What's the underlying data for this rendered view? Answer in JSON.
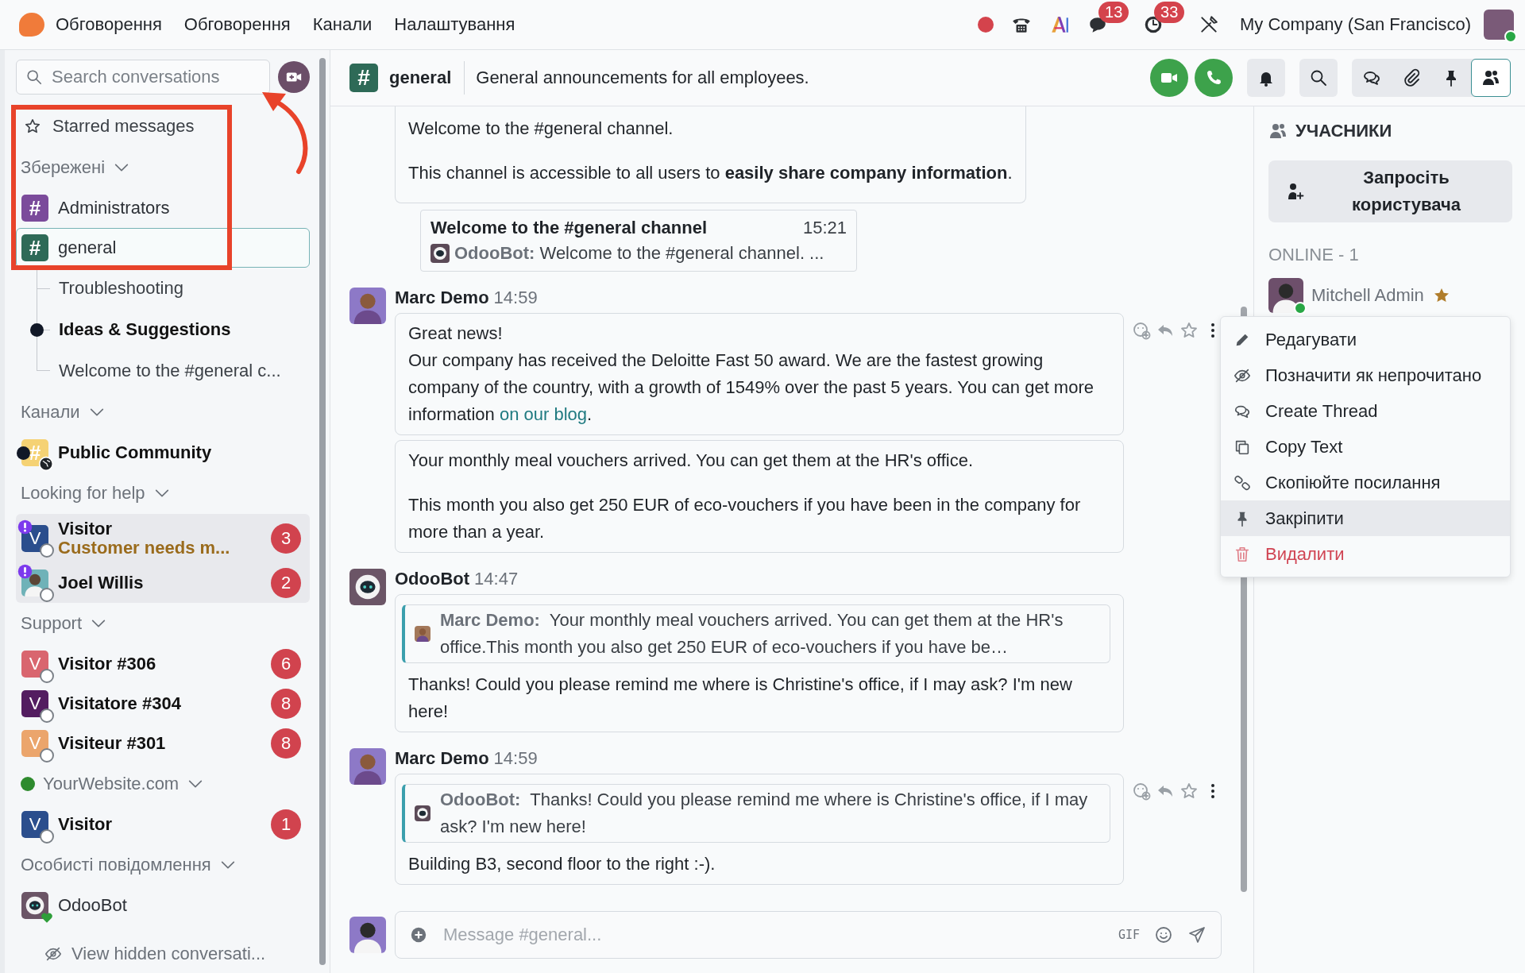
{
  "navbar": {
    "menu": [
      {
        "label": "Обговорення",
        "kind": "brand"
      },
      {
        "label": "Обговорення",
        "kind": "menu"
      },
      {
        "label": "Канали",
        "kind": "menu"
      },
      {
        "label": "Налаштування",
        "kind": "menu"
      }
    ],
    "systray": [
      {
        "kind": "recording"
      },
      {
        "kind": "phone"
      },
      {
        "kind": "ai"
      },
      {
        "kind": "messages",
        "count": "13"
      },
      {
        "kind": "activities",
        "count": "33"
      },
      {
        "kind": "tools"
      }
    ],
    "company": "My Company (San Francisco)",
    "user_online": true
  },
  "sidebar": {
    "search": {
      "placeholder": "Search conversations"
    },
    "starred": "Starred messages",
    "sections": [
      {
        "title": "Збережені",
        "online": false,
        "items": [
          {
            "kind": "channel",
            "symbol": "#",
            "name": "Administrators",
            "color": "#7b4b9b",
            "selected": false,
            "unread": false,
            "highlighted": false
          },
          {
            "kind": "channel",
            "symbol": "#",
            "name": "general",
            "color": "#2e6a57",
            "selected": true,
            "unread": false,
            "highlighted": false,
            "children": [
              {
                "name": "Troubleshooting",
                "unread": false
              },
              {
                "name": "Ideas & Suggestions",
                "unread": true
              },
              {
                "name": "Welcome to the #general c...",
                "unread": false
              }
            ]
          }
        ]
      },
      {
        "title": "Канали",
        "online": false,
        "items": [
          {
            "kind": "community",
            "symbol": "#",
            "name": "Public Community",
            "color": "#f5d274",
            "selected": false,
            "unread": true,
            "highlighted": false
          }
        ]
      },
      {
        "title": "Looking for help",
        "online": false,
        "items": [
          {
            "kind": "visitor",
            "initial": "V",
            "name": "Visitor",
            "subtitle": "Customer needs m...",
            "color": "#2b4e8d",
            "counter": "3",
            "alert": true,
            "online": false,
            "selected": false,
            "unread": true,
            "highlighted": true
          },
          {
            "kind": "person",
            "name": "Joel Willis",
            "color": "#6fb2b8",
            "counter": "2",
            "alert": true,
            "online": false,
            "selected": false,
            "unread": true,
            "highlighted": true
          }
        ]
      },
      {
        "title": "Support",
        "online": false,
        "items": [
          {
            "kind": "visitor",
            "initial": "V",
            "name": "Visitor #306",
            "color": "#d9666f",
            "counter": "6",
            "alert": false,
            "online": false,
            "selected": false,
            "unread": true,
            "highlighted": false
          },
          {
            "kind": "visitor",
            "initial": "V",
            "name": "Visitatore #304",
            "color": "#531d60",
            "counter": "8",
            "alert": false,
            "online": false,
            "selected": false,
            "unread": true,
            "highlighted": false
          },
          {
            "kind": "visitor",
            "initial": "V",
            "name": "Visiteur #301",
            "color": "#eba56c",
            "counter": "8",
            "alert": false,
            "online": false,
            "selected": false,
            "unread": true,
            "highlighted": false
          }
        ]
      },
      {
        "title": "YourWebsite.com",
        "online": true,
        "items": [
          {
            "kind": "visitor",
            "initial": "V",
            "name": "Visitor",
            "color": "#2b4e8d",
            "counter": "1",
            "alert": false,
            "online": false,
            "selected": false,
            "unread": true,
            "highlighted": false
          }
        ]
      },
      {
        "title": "Особисті повідомлення",
        "online": false,
        "items": [
          {
            "kind": "bot",
            "name": "OdooBot",
            "online": true,
            "selected": false,
            "unread": false,
            "highlighted": false
          }
        ]
      }
    ],
    "hidden_link": "View hidden conversati..."
  },
  "header": {
    "symbol": "#",
    "name": "general",
    "color": "#2e6a57",
    "description": "General announcements for all employees.",
    "actions": [
      {
        "kind": "video"
      },
      {
        "kind": "call"
      },
      {
        "kind": "notifications"
      },
      {
        "kind": "search"
      }
    ],
    "panel_tabs": [
      {
        "kind": "threads",
        "selected": false
      },
      {
        "kind": "attachments",
        "selected": false
      },
      {
        "kind": "pinned",
        "selected": false
      },
      {
        "kind": "members",
        "selected": true
      }
    ]
  },
  "messages": [
    {
      "bubbles": [
        {
          "actions": false,
          "paragraphs": [
            [
              {
                "text": "Welcome to the #general channel.",
                "link": false
              }
            ],
            [
              {
                "text": "This channel is accessible to all users to **easily share company information**.",
                "link": false
              }
            ]
          ]
        }
      ],
      "thread": {
        "title": "Welcome to the #general channel",
        "time": "15:21",
        "author": "OdooBot:",
        "preview": "Welcome to the #general channel. ..."
      }
    },
    {
      "author": "Marc Demo",
      "kind": "person",
      "time": "14:59",
      "bubbles": [
        {
          "actions": true,
          "paragraphs": [
            [
              {
                "text": "Great news!\nOur company has received the Deloitte Fast 50 award. We are the fastest growing company of the country, with a growth of 1549% over the past 5 years. You can get more information ",
                "link": false
              },
              {
                "text": "on our blog",
                "link": true
              },
              {
                "text": ".",
                "link": false
              }
            ]
          ]
        },
        {
          "actions": false,
          "paragraphs": [
            [
              {
                "text": "Your monthly meal vouchers arrived. You can get them at the HR's office.",
                "link": false
              }
            ],
            [
              {
                "text": "This month you also get 250 EUR of eco-vouchers if you have been in the company for more than a year.",
                "link": false
              }
            ]
          ]
        }
      ]
    },
    {
      "author": "OdooBot",
      "kind": "bot",
      "time": "14:47",
      "bubbles": [
        {
          "actions": false,
          "quote": {
            "author": "Marc Demo:",
            "kind": "person",
            "text": "Your monthly meal vouchers arrived. You can get them at the HR's office.This month you also get 250 EUR of eco-vouchers if you have be…"
          },
          "paragraphs": [
            [
              {
                "text": "Thanks! Could you please remind me where is Christine's office, if I may ask? I'm new here!",
                "link": false
              }
            ]
          ]
        }
      ]
    },
    {
      "author": "Marc Demo",
      "kind": "person",
      "time": "14:59",
      "bubbles": [
        {
          "actions": true,
          "quote": {
            "author": "OdooBot:",
            "kind": "bot",
            "text": "Thanks! Could you please remind me where is Christine's office, if I may ask? I'm new here!"
          },
          "paragraphs": [
            [
              {
                "text": "Building B3, second floor to the right :-).",
                "link": false
              }
            ]
          ]
        }
      ]
    }
  ],
  "composer": {
    "placeholder": "Message #general...",
    "gif_label": "GIF"
  },
  "members_panel": {
    "title": "УЧАСНИКИ",
    "invite": "Запросіть користувача",
    "online_label": "ONLINE - 1",
    "members": [
      {
        "name": "Mitchell Admin",
        "online": true,
        "owner": true
      }
    ]
  },
  "context_menu": [
    {
      "kind": "edit",
      "label": "Редагувати",
      "selected": false,
      "danger": false
    },
    {
      "kind": "unread",
      "label": "Позначити як непрочитано",
      "selected": false,
      "danger": false
    },
    {
      "kind": "thread",
      "label": "Create Thread",
      "selected": false,
      "danger": false
    },
    {
      "kind": "copy",
      "label": "Copy Text",
      "selected": false,
      "danger": false
    },
    {
      "kind": "link",
      "label": "Скопіюйте посилання",
      "selected": false,
      "danger": false
    },
    {
      "kind": "pin",
      "label": "Закріпити",
      "selected": true,
      "danger": false
    },
    {
      "kind": "delete",
      "label": "Видалити",
      "selected": false,
      "danger": true
    }
  ]
}
